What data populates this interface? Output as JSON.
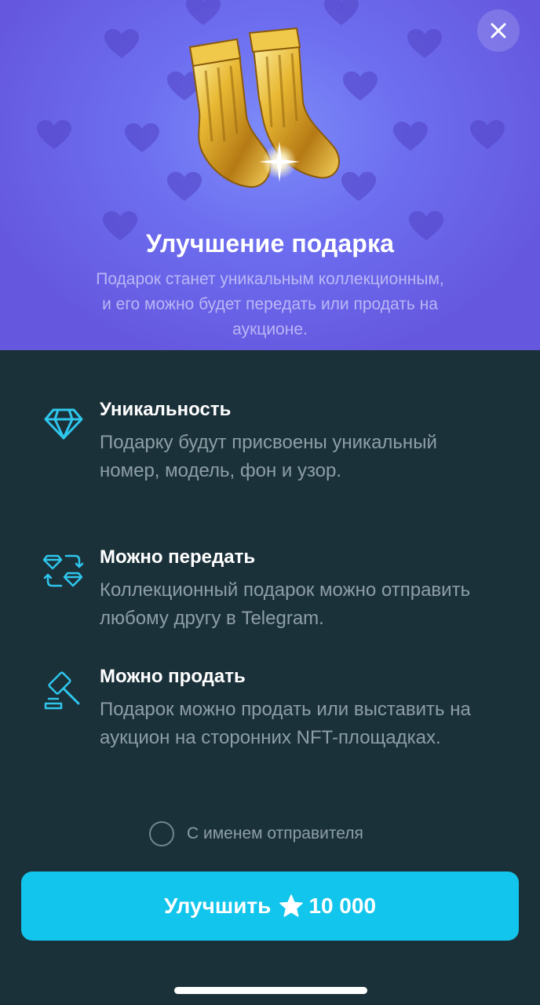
{
  "header": {
    "title": "Улучшение подарка",
    "subtitle": "Подарок станет уникальным коллекционным, и его можно будет передать или продать на аукционе.",
    "close_icon": "close-icon",
    "gift_icon": "golden-socks-icon",
    "background_colors": [
      "#7d8cf8",
      "#6558df"
    ]
  },
  "features": [
    {
      "icon": "diamond-icon",
      "title": "Уникальность",
      "text": "Подарку будут присвоены уникальный номер, модель, фон и узор."
    },
    {
      "icon": "transfer-icon",
      "title": "Можно передать",
      "text": "Коллекционный подарок можно отправить любому другу в Telegram."
    },
    {
      "icon": "auction-gavel-icon",
      "title": "Можно продать",
      "text": "Подарок можно продать или выставить на аукцион на сторонних NFT-площадках."
    }
  ],
  "sender_option": {
    "label": "С именем отправителя",
    "checked": false
  },
  "upgrade_button": {
    "label": "Улучшить",
    "price": "10 000",
    "currency_icon": "star-icon"
  },
  "colors": {
    "accent": "#12c5ec",
    "background": "#1b313a",
    "icon": "#2ec6ec",
    "muted_text": "#8d9ea6"
  }
}
